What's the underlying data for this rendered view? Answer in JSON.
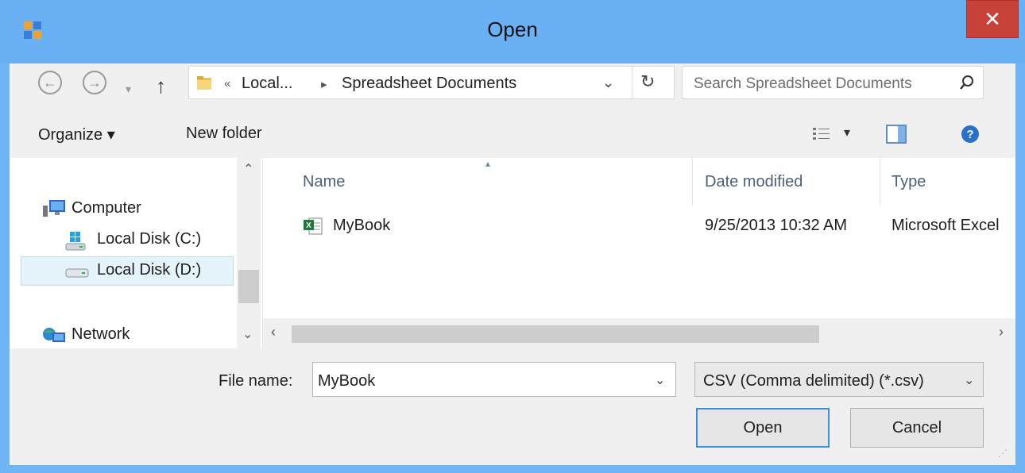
{
  "window": {
    "title": "Open",
    "close_glyph": "✕"
  },
  "nav": {
    "back_icon": "←",
    "forward_icon": "→",
    "up_icon": "↑",
    "breadcrumb": {
      "overflow": "«",
      "part1": "Local...",
      "sep": "▸",
      "part2": "Spreadsheet Documents"
    },
    "dropdown_glyph": "⌄",
    "refresh_glyph": "↻",
    "search_placeholder": "Search Spreadsheet Documents"
  },
  "toolbar": {
    "organize": "Organize ▾",
    "new_folder": "New folder"
  },
  "navpane": {
    "items": [
      {
        "label": "Computer"
      },
      {
        "label": "Local Disk (C:)"
      },
      {
        "label": "Local Disk (D:)",
        "selected": true
      },
      {
        "label": "Network"
      }
    ]
  },
  "files": {
    "columns": {
      "name": "Name",
      "date": "Date modified",
      "type": "Type"
    },
    "rows": [
      {
        "name": "MyBook",
        "date": "9/25/2013 10:32 AM",
        "type": "Microsoft Excel"
      }
    ]
  },
  "bottom": {
    "filename_label": "File name:",
    "filename_value": "MyBook",
    "filter_value": "CSV (Comma delimited) (*.csv)",
    "open_label": "Open",
    "cancel_label": "Cancel"
  },
  "colors": {
    "titlebar": "#69b1f4",
    "close": "#c8423a",
    "selection": "#e5f3fb"
  }
}
